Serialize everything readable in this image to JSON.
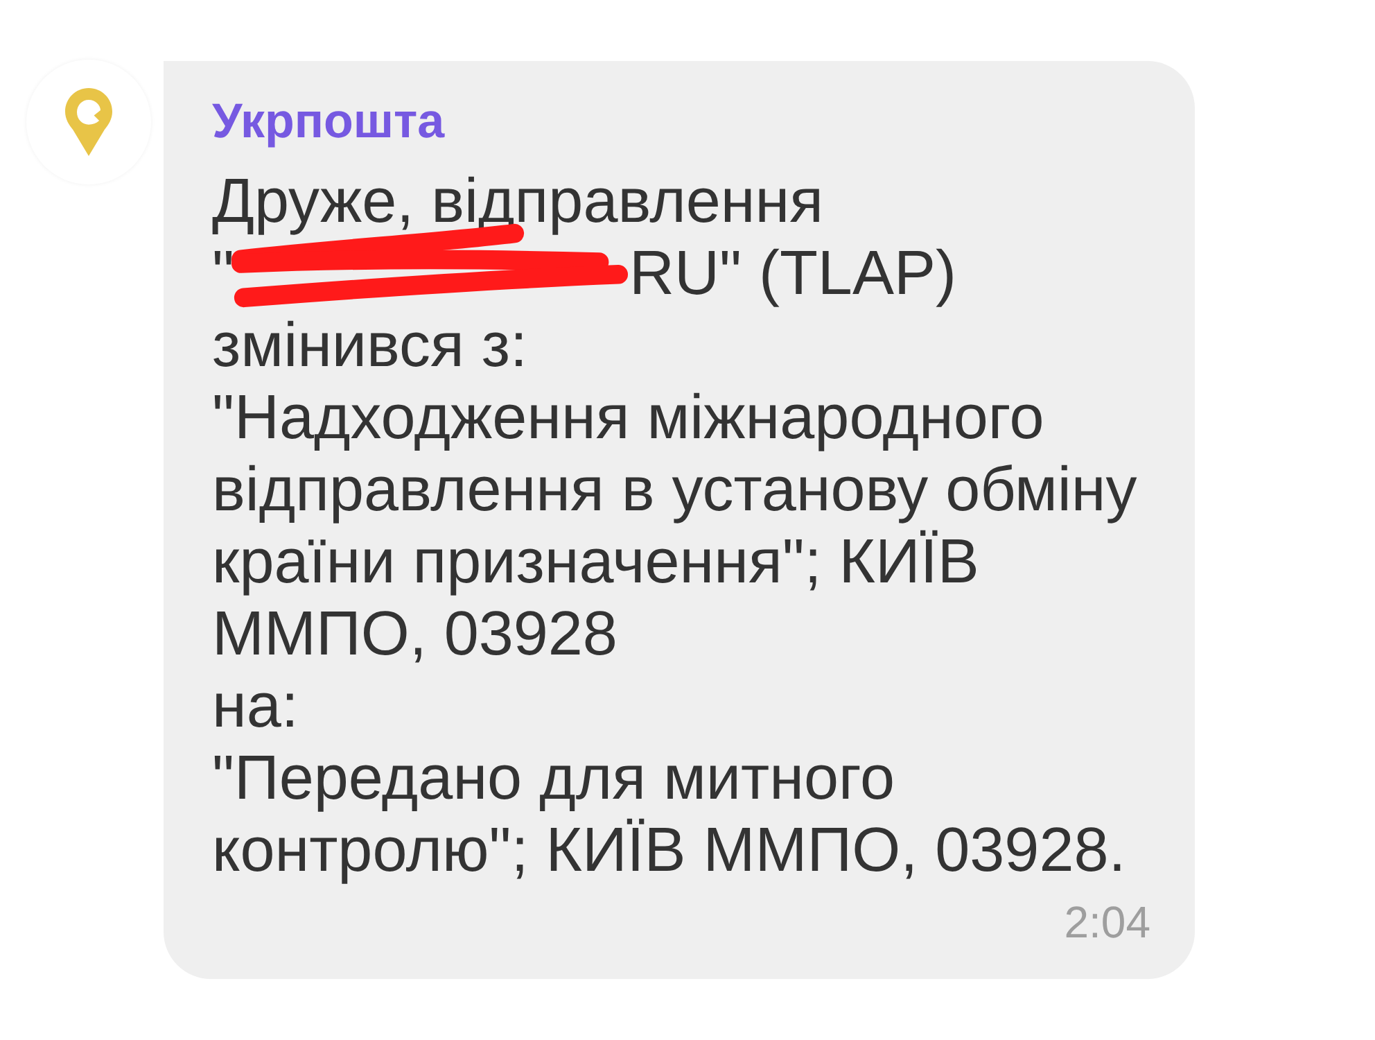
{
  "message": {
    "sender": "Укрпошта",
    "lines": [
      {
        "kind": "text",
        "text": "Друже, відправлення"
      },
      {
        "kind": "redacted",
        "before": "\"",
        "after": "RU\" (TLAP)"
      },
      {
        "kind": "text",
        "text": "змінився з:"
      },
      {
        "kind": "text",
        "text": "\"Надходження міжнародного відправлення в установу обміну країни призначення\"; КИЇВ ММПО, 03928"
      },
      {
        "kind": "text",
        "text": "на:"
      },
      {
        "kind": "text",
        "text": "\"Передано для митного контролю\"; КИЇВ ММПО, 03928."
      }
    ],
    "time": "2:04"
  }
}
